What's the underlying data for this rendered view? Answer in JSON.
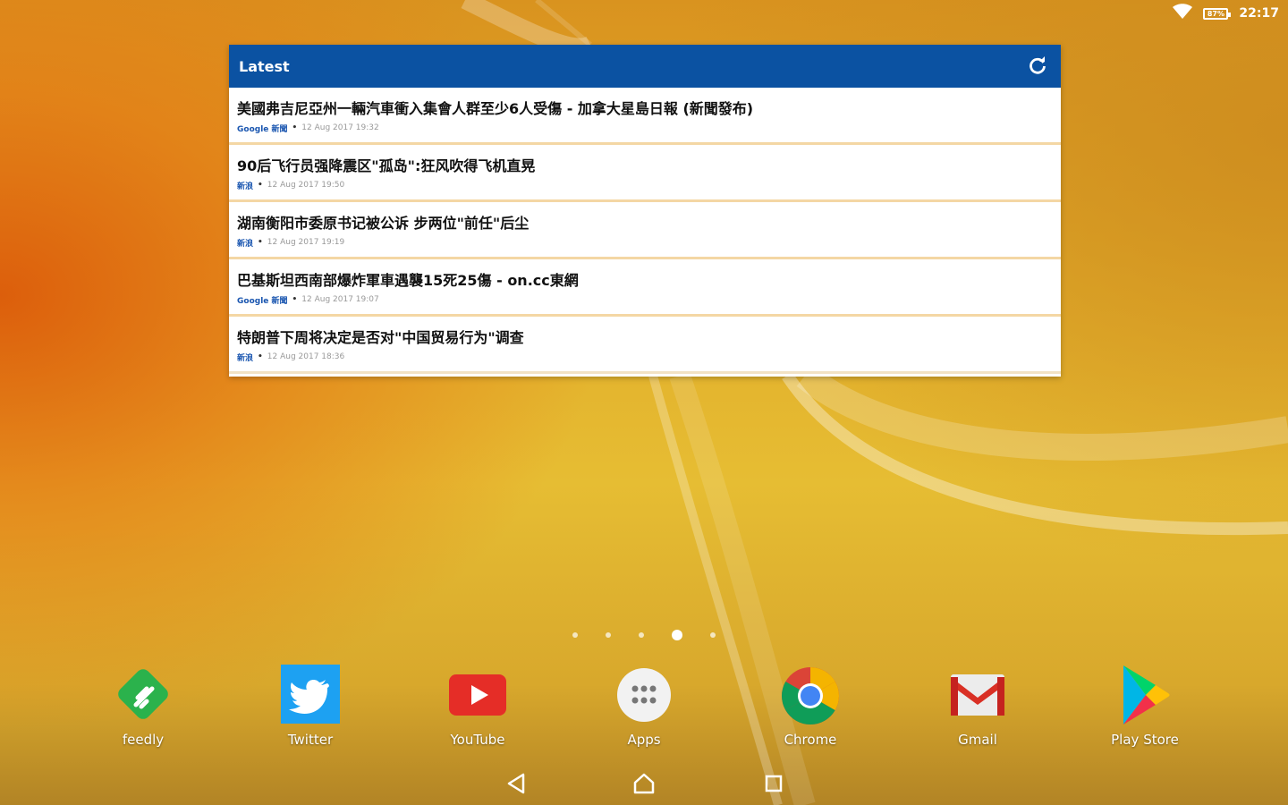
{
  "status_bar": {
    "battery_level": "87%",
    "time": "22:17"
  },
  "widget": {
    "title": "Latest",
    "items": [
      {
        "title": "美國弗吉尼亞州一輛汽車衝入集會人群至少6人受傷 - 加拿大星島日報 (新聞發布)",
        "source": "Google 新聞",
        "date": "12 Aug 2017 19:32"
      },
      {
        "title": "90后飞行员强降震区\"孤岛\":狂风吹得飞机直晃",
        "source": "新浪",
        "date": "12 Aug 2017 19:50"
      },
      {
        "title": "湖南衡阳市委原书记被公诉 步两位\"前任\"后尘",
        "source": "新浪",
        "date": "12 Aug 2017 19:19"
      },
      {
        "title": "巴基斯坦西南部爆炸軍車遇襲15死25傷 - on.cc東網",
        "source": "Google 新聞",
        "date": "12 Aug 2017 19:07"
      },
      {
        "title": "特朗普下周将决定是否对\"中国贸易行为\"调查",
        "source": "新浪",
        "date": "12 Aug 2017 18:36"
      }
    ]
  },
  "page_indicator": {
    "count": 5,
    "active_index": 3
  },
  "dock": {
    "apps": [
      {
        "label": "feedly",
        "icon": "feedly-icon"
      },
      {
        "label": "Twitter",
        "icon": "twitter-icon"
      },
      {
        "label": "YouTube",
        "icon": "youtube-icon"
      },
      {
        "label": "Apps",
        "icon": "apps-grid-icon"
      },
      {
        "label": "Chrome",
        "icon": "chrome-icon"
      },
      {
        "label": "Gmail",
        "icon": "gmail-icon"
      },
      {
        "label": "Play Store",
        "icon": "play-store-icon"
      }
    ]
  },
  "colors": {
    "widget_header": "#0b52a2",
    "source_link": "#1a56b0",
    "feedly": "#2bb24c",
    "twitter": "#1da1f2",
    "youtube": "#e52d27",
    "gmail": "#d93025"
  }
}
